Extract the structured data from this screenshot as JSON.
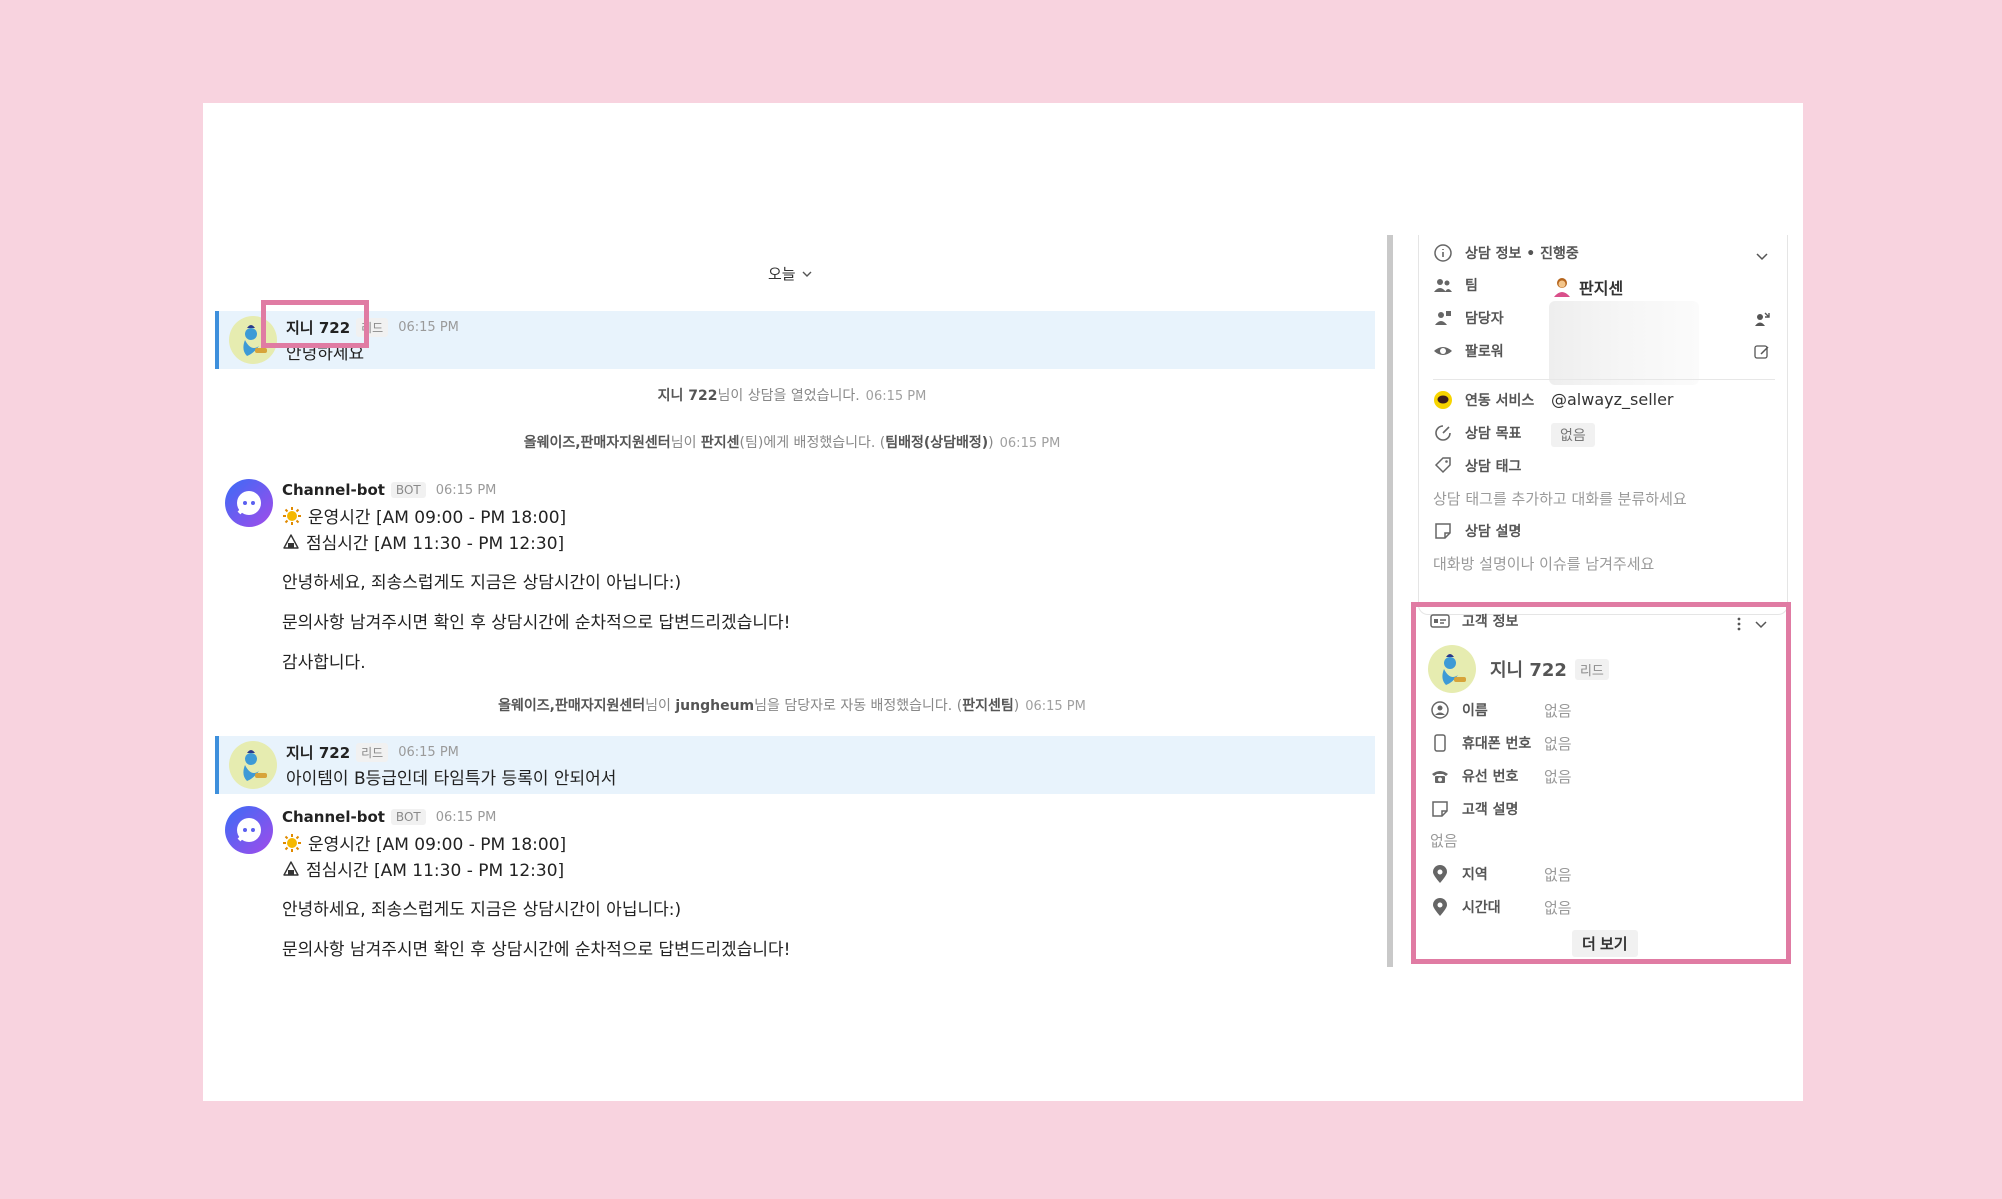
{
  "date_separator": "오늘",
  "messages": [
    {
      "name": "지니 722",
      "badge": "리드",
      "time": "06:15 PM",
      "text": "안녕하세요"
    },
    {
      "name": "Channel-bot",
      "badge": "BOT",
      "time": "06:15 PM",
      "hours": "운영시간 [AM 09:00 - PM 18:00]",
      "lunch": "점심시간  [AM 11:30 - PM 12:30]",
      "line1": "안녕하세요, 죄송스럽게도 지금은 상담시간이 아닙니다:)",
      "line2": "문의사항 남겨주시면 확인 후 상담시간에 순차적으로 답변드리겠습니다!",
      "line3": "감사합니다."
    },
    {
      "name": "지니 722",
      "badge": "리드",
      "time": "06:15 PM",
      "text": "아이템이 B등급인데 타임특가 등록이 안되어서"
    },
    {
      "name": "Channel-bot",
      "badge": "BOT",
      "time": "06:15 PM",
      "hours": "운영시간 [AM 09:00 - PM 18:00]",
      "lunch": "점심시간  [AM 11:30 - PM 12:30]",
      "line1": "안녕하세요, 죄송스럽게도 지금은 상담시간이 아닙니다:)",
      "line2": "문의사항 남겨주시면 확인 후 상담시간에 순차적으로 답변드리겠습니다!"
    }
  ],
  "system": [
    {
      "b1": "지니 722",
      "t1": "님이 상담을 열었습니다.",
      "time": "06:15 PM"
    },
    {
      "b1": "올웨이즈,판매자지원센터",
      "t1": "님이 ",
      "b2": "판지센",
      "t2": "(팀)에게 배정했습니다. (",
      "b3": "팀배정(상담배정)",
      "t3": ")",
      "time": "06:15 PM"
    },
    {
      "b1": "올웨이즈,판매자지원센터",
      "t1": "님이 ",
      "b2": "jungheum",
      "t2": "님을 담당자로 자동 배정했습니다. (",
      "b3": "판지센팀",
      "t3": ")",
      "time": "06:15 PM"
    }
  ],
  "consult_panel": {
    "header": "상담 정보 • 진행중",
    "team_label": "팀",
    "team_value": "판지센",
    "assignee_label": "담당자",
    "follower_label": "팔로워",
    "linked_label": "연동 서비스",
    "linked_value": "@alwayz_seller",
    "goal_label": "상담 목표",
    "goal_value": "없음",
    "tag_label": "상담 태그",
    "tag_placeholder": "상담 태그를 추가하고 대화를 분류하세요",
    "desc_label": "상담 설명",
    "desc_placeholder": "대화방 설명이나 이슈를 남겨주세요"
  },
  "customer_panel": {
    "header": "고객 정보",
    "name": "지니 722",
    "badge": "리드",
    "fields": [
      {
        "label": "이름",
        "value": "없음"
      },
      {
        "label": "휴대폰 번호",
        "value": "없음"
      },
      {
        "label": "유선 번호",
        "value": "없음"
      },
      {
        "label": "고객 설명",
        "value": "없음"
      },
      {
        "label": "지역",
        "value": "없음"
      },
      {
        "label": "시간대",
        "value": "없음"
      }
    ],
    "more": "더 보기"
  },
  "colors": {
    "background": "#f8d3df",
    "highlight": "#e07ba3",
    "user_bubble": "#e8f3fc",
    "accent_bar": "#3d8fdc"
  }
}
